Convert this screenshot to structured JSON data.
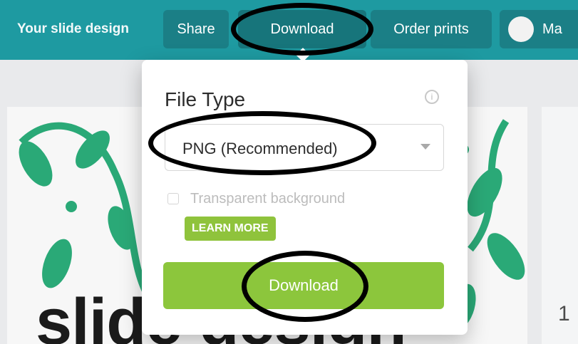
{
  "topbar": {
    "title": "Your slide design",
    "buttons": {
      "share": "Share",
      "download": "Download",
      "order": "Order prints"
    },
    "account_label": "Ma"
  },
  "download_panel": {
    "file_type_label": "File Type",
    "select_value": "PNG (Recommended)",
    "checkbox_label": "Transparent background",
    "learn_more": "LEARN MORE",
    "download_button": "Download"
  },
  "design": {
    "word": "slide design",
    "page_number": "1"
  },
  "colors": {
    "topbar": "#1e9aa1",
    "primary_button": "#8cc63c",
    "annotation": "#000000"
  }
}
